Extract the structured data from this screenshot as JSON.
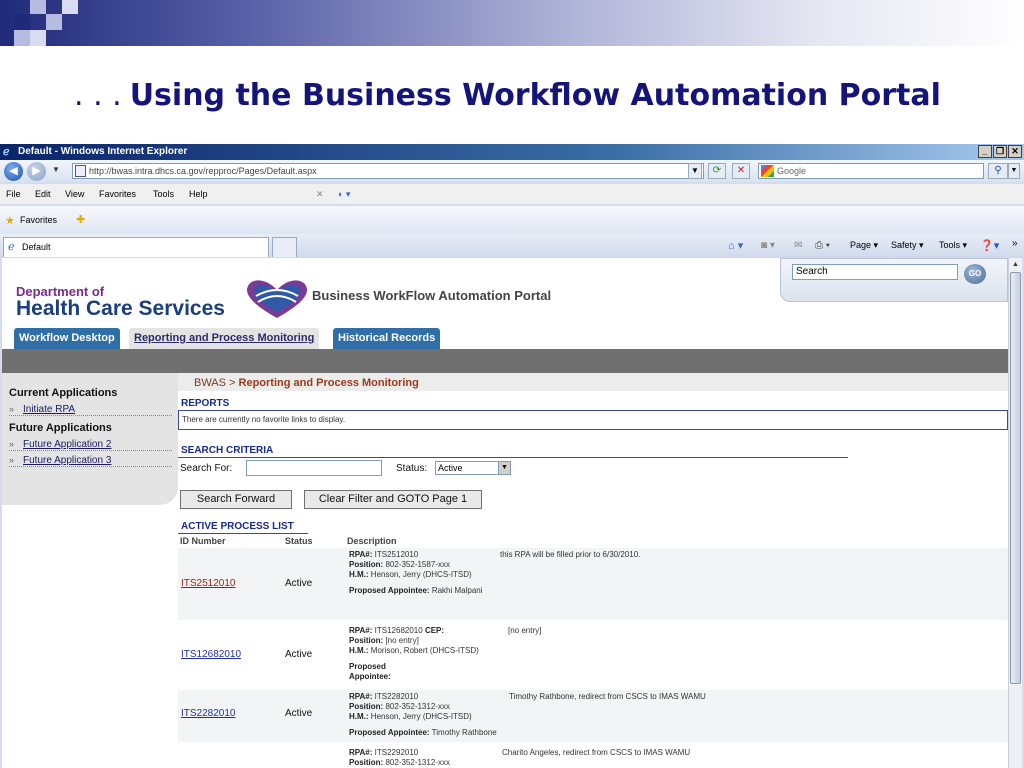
{
  "slide": {
    "title_dots": ". . .",
    "title": "Using the Business Workflow Automation Portal"
  },
  "window": {
    "title": "Default - Windows Internet Explorer",
    "url": "http://bwas.intra.dhcs.ca.gov/repproc/Pages/Default.aspx",
    "search_placeholder": "Google"
  },
  "menu": [
    "File",
    "Edit",
    "View",
    "Favorites",
    "Tools",
    "Help"
  ],
  "favorites_label": "Favorites",
  "tab_label": "Default",
  "commands": {
    "page": "Page ▾",
    "safety": "Safety ▾",
    "tools": "Tools ▾"
  },
  "portal": {
    "dept_line1": "Department of",
    "dept_line2": "Health Care Services",
    "title": "Business WorkFlow Automation Portal",
    "search_value": "Search",
    "go_label": "GO",
    "tabs": [
      "Workflow Desktop",
      "Reporting and Process Monitoring",
      "Historical Records"
    ]
  },
  "sidebar": {
    "current_heading": "Current Applications",
    "current_items": [
      "Initiate RPA"
    ],
    "future_heading": "Future Applications",
    "future_items": [
      "Future Application 2",
      "Future Application 3"
    ]
  },
  "breadcrumb": {
    "root": "BWAS >",
    "current": "Reporting and Process Monitoring"
  },
  "reports": {
    "heading": "REPORTS",
    "empty_message": "There are currently no favorite links to display."
  },
  "search_criteria": {
    "heading": "SEARCH CRITERIA",
    "search_for_label": "Search For:",
    "search_for_value": "",
    "status_label": "Status:",
    "status_value": "Active",
    "search_button": "Search Forward",
    "clear_button": "Clear Filter and GOTO Page 1"
  },
  "process_list": {
    "heading": "ACTIVE PROCESS LIST",
    "columns": [
      "ID Number",
      "Status",
      "Description"
    ],
    "rows": [
      {
        "id": "ITS2512010",
        "status": "Active",
        "rpa_label": "RPA#:",
        "rpa": "ITS2512010",
        "note": "this RPA will be filled prior to 6/30/2010.",
        "position_label": "Position:",
        "position": "802-352-1587-xxx",
        "hm_label": "H.M.:",
        "hm": "Henson, Jerry (DHCS-ITSD)",
        "appointee_label": "Proposed Appointee:",
        "appointee": "Rakhi Malpani"
      },
      {
        "id": "ITS12682010",
        "status": "Active",
        "rpa_label": "RPA#:",
        "rpa": "ITS12682010",
        "cep_label": "CEP:",
        "note": "[no entry]",
        "position_label": "Position:",
        "position": "[no entry]",
        "hm_label": "H.M.:",
        "hm": "Morison, Robert (DHCS-ITSD)",
        "appointee_label": "Proposed Appointee:",
        "appointee": ""
      },
      {
        "id": "ITS2282010",
        "status": "Active",
        "rpa_label": "RPA#:",
        "rpa": "ITS2282010",
        "note": "Timothy Rathbone, redirect from CSCS to IMAS WAMU",
        "position_label": "Position:",
        "position": "802-352-1312-xxx",
        "hm_label": "H.M.:",
        "hm": "Henson, Jerry (DHCS-ITSD)",
        "appointee_label": "Proposed Appointee:",
        "appointee": "Timothy Rathbone"
      },
      {
        "id": "",
        "status": "",
        "rpa_label": "RPA#:",
        "rpa": "ITS2292010",
        "note": "Charito Angeles, redirect from CSCS to IMAS WAMU",
        "position_label": "Position:",
        "position": "802-352-1312-xxx"
      }
    ]
  }
}
